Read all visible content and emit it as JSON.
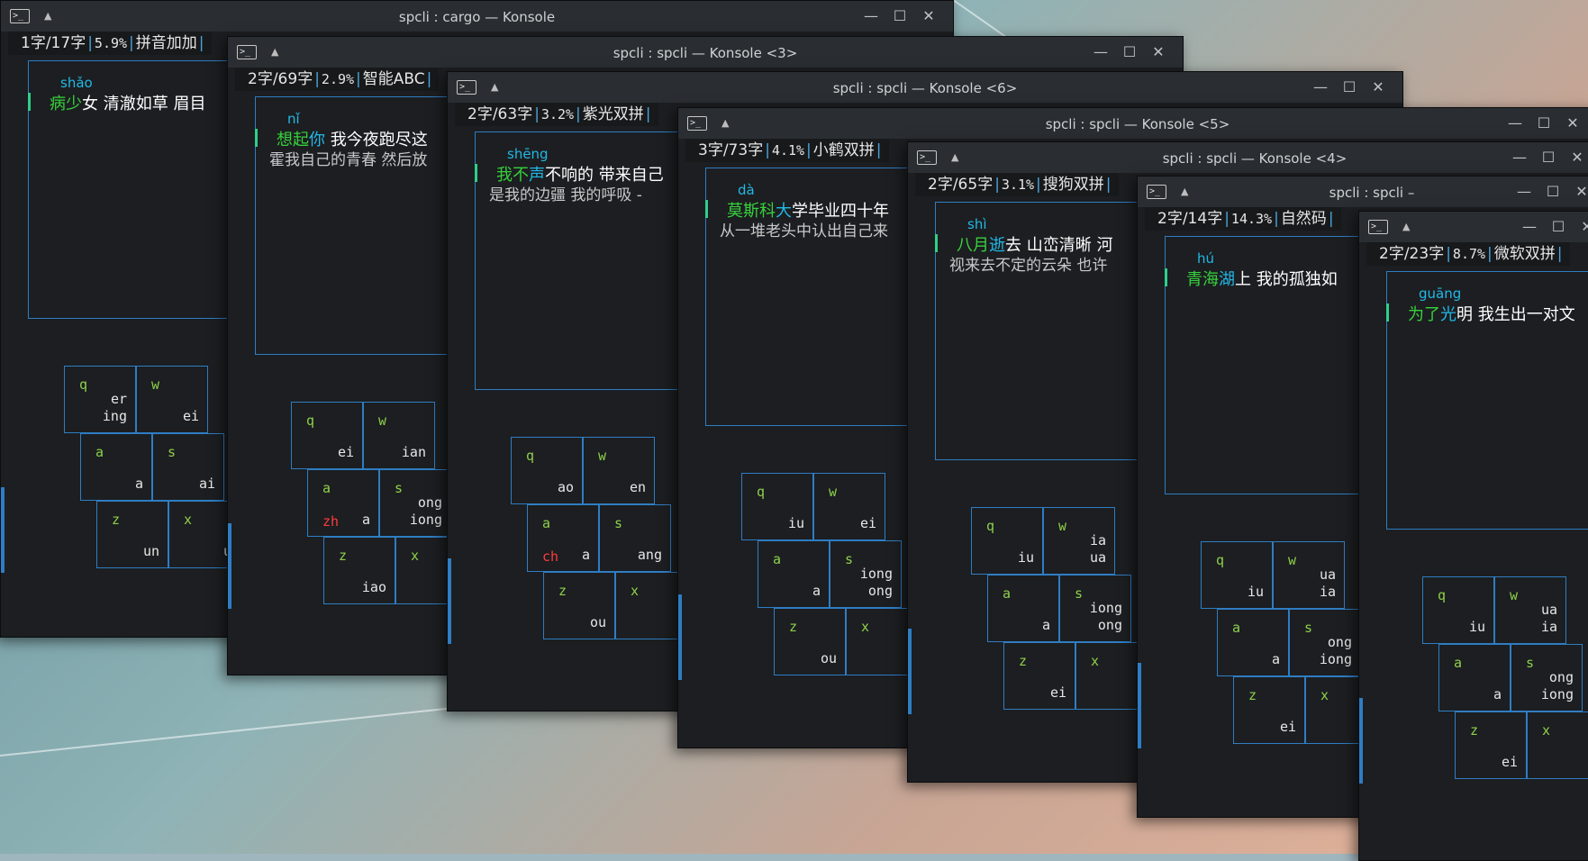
{
  "windows": [
    {
      "id": "w1",
      "title": "spcli : cargo — Konsole",
      "count": "1字",
      "total": "/17字",
      "pct": "5.9%",
      "scheme": "拼音加加",
      "pinyin": "shǎo",
      "line1": [
        {
          "t": "病少",
          "c": "g"
        },
        {
          "t": "女 清澈如草 眉目",
          "c": "w"
        }
      ],
      "line2": "",
      "keys": [
        [
          "q",
          "",
          "er\ning"
        ],
        [
          "w",
          "",
          "ei"
        ],
        [
          "a",
          "",
          "a"
        ],
        [
          "s",
          "",
          "ai"
        ],
        [
          "z",
          "",
          "un"
        ],
        [
          "x",
          "",
          "u"
        ]
      ]
    },
    {
      "id": "w2",
      "title": "spcli : spcli — Konsole <3>",
      "count": "2字",
      "total": "/69字",
      "pct": "2.9%",
      "scheme": "智能ABC",
      "pinyin": "nǐ",
      "line1": [
        {
          "t": "想起",
          "c": "g"
        },
        {
          "t": "你",
          "c": "c"
        },
        {
          "t": " 我今夜跑尽这",
          "c": "w"
        }
      ],
      "line2": "霍我自己的青春 然后放",
      "keys": [
        [
          "q",
          "",
          "ei"
        ],
        [
          "w",
          "",
          "ian"
        ],
        [
          "a",
          "zh",
          "a"
        ],
        [
          "s",
          "",
          "ong\niong"
        ],
        [
          "z",
          "",
          "iao"
        ],
        [
          "x",
          "",
          ""
        ]
      ]
    },
    {
      "id": "w3",
      "title": "spcli : spcli — Konsole <6>",
      "count": "2字",
      "total": "/63字",
      "pct": "3.2%",
      "scheme": "紫光双拼",
      "pinyin": "shēng",
      "line1": [
        {
          "t": "我不",
          "c": "g"
        },
        {
          "t": "声",
          "c": "c"
        },
        {
          "t": "不响的 带来自己",
          "c": "w"
        }
      ],
      "line2": "是我的边疆 我的呼吸 -",
      "keys": [
        [
          "q",
          "",
          "ao"
        ],
        [
          "w",
          "",
          "en"
        ],
        [
          "a",
          "ch",
          "a"
        ],
        [
          "s",
          "",
          "ang"
        ],
        [
          "z",
          "",
          "ou"
        ],
        [
          "x",
          "",
          ""
        ]
      ]
    },
    {
      "id": "w4",
      "title": "spcli : spcli — Konsole <5>",
      "count": "3字",
      "total": "/73字",
      "pct": "4.1%",
      "scheme": "小鹤双拼",
      "pinyin": "dà",
      "line1": [
        {
          "t": "莫斯科",
          "c": "g"
        },
        {
          "t": "大",
          "c": "c"
        },
        {
          "t": "学毕业四十年",
          "c": "w"
        }
      ],
      "line2": "从一堆老头中认出自己来",
      "keys": [
        [
          "q",
          "",
          "iu"
        ],
        [
          "w",
          "",
          "ei"
        ],
        [
          "a",
          "",
          "a"
        ],
        [
          "s",
          "",
          "iong\nong"
        ],
        [
          "z",
          "",
          "ou"
        ],
        [
          "x",
          "",
          ""
        ]
      ]
    },
    {
      "id": "w5",
      "title": "spcli : spcli — Konsole <4>",
      "count": "2字",
      "total": "/65字",
      "pct": "3.1%",
      "scheme": "搜狗双拼",
      "pinyin": "shì",
      "line1": [
        {
          "t": "八月",
          "c": "g"
        },
        {
          "t": "逝",
          "c": "c"
        },
        {
          "t": "去 山峦清晰 河",
          "c": "w"
        }
      ],
      "line2": "视来去不定的云朵 也许",
      "keys": [
        [
          "q",
          "",
          "iu"
        ],
        [
          "w",
          "",
          "ia\nua"
        ],
        [
          "a",
          "",
          "a"
        ],
        [
          "s",
          "",
          "iong\nong"
        ],
        [
          "z",
          "",
          "ei"
        ],
        [
          "x",
          "",
          ""
        ]
      ]
    },
    {
      "id": "w6",
      "title": "spcli : spcli –",
      "count": "2字",
      "total": "/14字",
      "pct": "14.3%",
      "scheme": "自然码",
      "pinyin": "hú",
      "line1": [
        {
          "t": "青海",
          "c": "g"
        },
        {
          "t": "湖",
          "c": "c"
        },
        {
          "t": "上 我的孤独如",
          "c": "w"
        }
      ],
      "line2": "",
      "keys": [
        [
          "q",
          "",
          "iu"
        ],
        [
          "w",
          "",
          "ua\nia"
        ],
        [
          "a",
          "",
          "a"
        ],
        [
          "s",
          "",
          "ong\niong"
        ],
        [
          "z",
          "",
          "ei"
        ],
        [
          "x",
          "",
          ""
        ]
      ]
    },
    {
      "id": "w7",
      "title": "",
      "count": "2字",
      "total": "/23字",
      "pct": "8.7%",
      "scheme": "微软双拼",
      "pinyin": "guāng",
      "line1": [
        {
          "t": "为了",
          "c": "g"
        },
        {
          "t": "光",
          "c": "c"
        },
        {
          "t": "明 我生出一对文",
          "c": "w"
        }
      ],
      "line2": "",
      "keys": [
        [
          "q",
          "",
          "iu"
        ],
        [
          "w",
          "",
          "ua\nia"
        ],
        [
          "a",
          "",
          "a"
        ],
        [
          "s",
          "",
          "ong\niong"
        ],
        [
          "z",
          "",
          "ei"
        ],
        [
          "x",
          "",
          ""
        ]
      ]
    }
  ]
}
